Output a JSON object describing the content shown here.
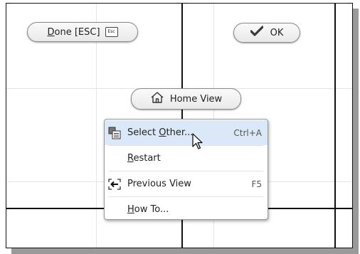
{
  "done_button": {
    "underline": "D",
    "rest": "one [ESC]",
    "esc_label": "Esc"
  },
  "ok_button": {
    "label": "OK"
  },
  "home_view_button": {
    "label": "Home View"
  },
  "context_menu": {
    "items": [
      {
        "label_pre": "Select ",
        "underline": "O",
        "label_post": "ther...",
        "shortcut": "Ctrl+A",
        "icon": "select-other-icon",
        "highlighted": true
      },
      {
        "label_pre": "",
        "underline": "R",
        "label_post": "estart",
        "shortcut": "",
        "icon": ""
      },
      {
        "label_pre": "Previous View",
        "underline": "",
        "label_post": "",
        "shortcut": "F5",
        "icon": "previous-view-icon"
      },
      {
        "label_pre": "",
        "underline": "H",
        "label_post": "ow To...",
        "shortcut": "",
        "icon": ""
      }
    ]
  },
  "colors": {
    "highlight": "#dbe8f8",
    "ok_check": "#3a3a3a"
  }
}
